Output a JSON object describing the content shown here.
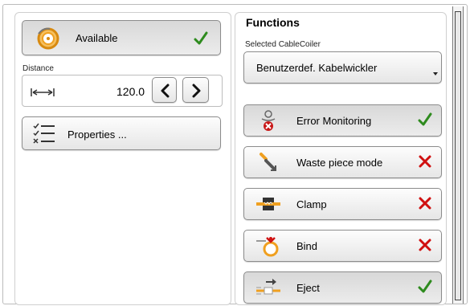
{
  "left": {
    "available_label": "Available",
    "distance_label": "Distance",
    "distance_value": "120.0",
    "properties_label": "Properties ..."
  },
  "right": {
    "title": "Functions",
    "selected_label": "Selected CableCoiler",
    "selected_value": "Benutzerdef. Kabelwickler",
    "functions": [
      {
        "label": "Error Monitoring",
        "status": "enabled"
      },
      {
        "label": "Waste piece mode",
        "status": "disabled"
      },
      {
        "label": "Clamp",
        "status": "disabled"
      },
      {
        "label": "Bind",
        "status": "disabled"
      },
      {
        "label": "Eject",
        "status": "enabled"
      }
    ]
  },
  "colors": {
    "check": "#2e8b1e",
    "cross": "#d01010",
    "accent": "#f0a020"
  }
}
